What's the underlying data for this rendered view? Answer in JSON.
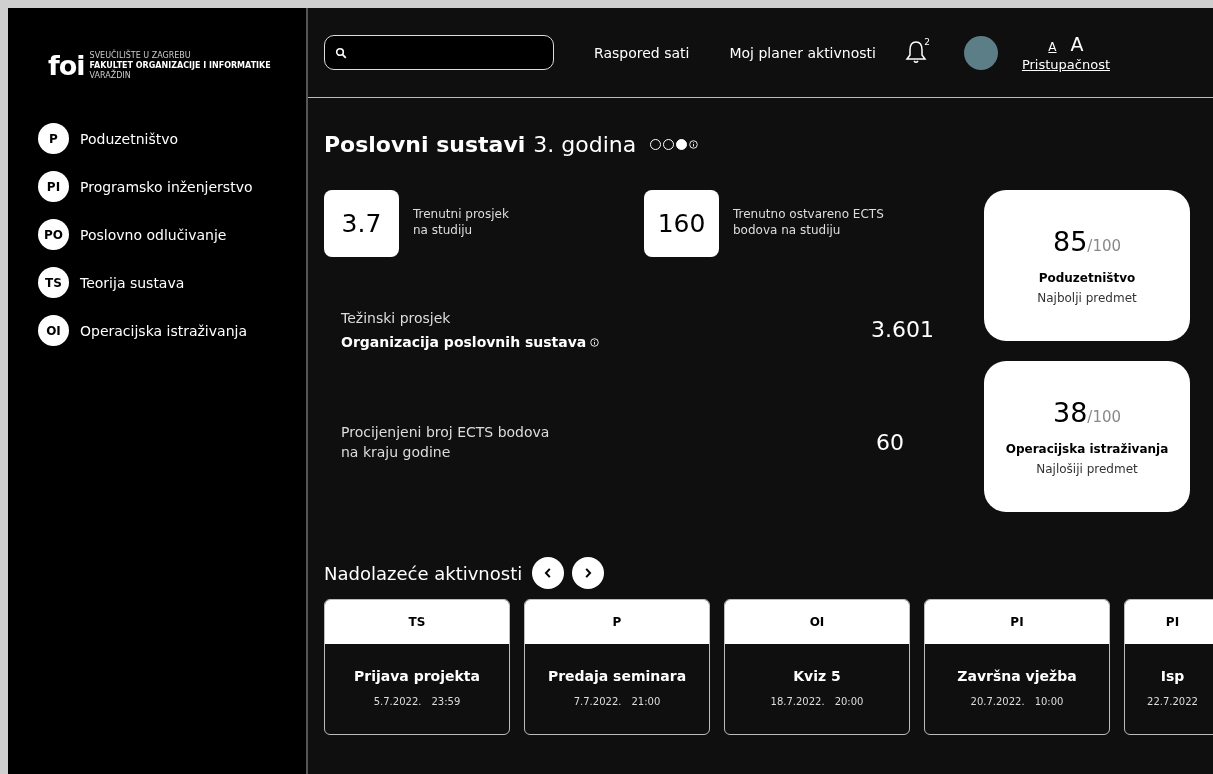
{
  "logo": {
    "mark": "foi",
    "lines": [
      "SVEUČILIŠTE U ZAGREBU",
      "FAKULTET ORGANIZACIJE I INFORMATIKE",
      "VARAŽDIN"
    ]
  },
  "sidebar": {
    "items": [
      {
        "badge": "P",
        "label": "Poduzetništvo"
      },
      {
        "badge": "PI",
        "label": "Programsko inženjerstvo"
      },
      {
        "badge": "PO",
        "label": "Poslovno odlučivanje"
      },
      {
        "badge": "TS",
        "label": "Teorija sustava"
      },
      {
        "badge": "OI",
        "label": "Operacijska istraživanja"
      }
    ]
  },
  "topbar": {
    "links": [
      "Raspored sati",
      "Moj planer aktivnosti"
    ],
    "notifications": {
      "count": "2"
    },
    "accessibility": {
      "small": "A",
      "large": "A",
      "label": "Pristupačnost"
    }
  },
  "heading": {
    "program": "Poslovni sustavi",
    "year": "3. godina",
    "year_steps": [
      {
        "selected": false
      },
      {
        "selected": false
      },
      {
        "selected": true
      }
    ]
  },
  "stats": [
    {
      "value": "3.7",
      "label": [
        "Trenutni prosjek",
        "na studiju"
      ]
    },
    {
      "value": "160",
      "label": [
        "Trenutno ostvareno ECTS",
        "bodova na studiju"
      ]
    }
  ],
  "weighted": {
    "label": "Težinski prosjek",
    "program": "Organizacija poslovnih sustava",
    "value": "3.601"
  },
  "estimate": {
    "label": [
      "Procijenjeni broj ECTS bodova",
      "na kraju godine"
    ],
    "value": "60"
  },
  "subjects": [
    {
      "score": "85",
      "max": "/100",
      "name": "Poduzetništvo",
      "note": "Najbolji predmet"
    },
    {
      "score": "38",
      "max": "/100",
      "name": "Operacijska istraživanja",
      "note": "Najlošiji predmet"
    }
  ],
  "activities": {
    "title": "Nadolazeće aktivnosti",
    "items": [
      {
        "subject": "TS",
        "name": "Prijava projekta",
        "date": "5.7.2022.",
        "time": "23:59"
      },
      {
        "subject": "P",
        "name": "Predaja seminara",
        "date": "7.7.2022.",
        "time": "21:00"
      },
      {
        "subject": "OI",
        "name": "Kviz 5",
        "date": "18.7.2022.",
        "time": "20:00"
      },
      {
        "subject": "PI",
        "name": "Završna vježba",
        "date": "20.7.2022.",
        "time": "10:00"
      },
      {
        "subject": "PI",
        "name": "Isp",
        "date": "22.7.2022"
      }
    ]
  }
}
